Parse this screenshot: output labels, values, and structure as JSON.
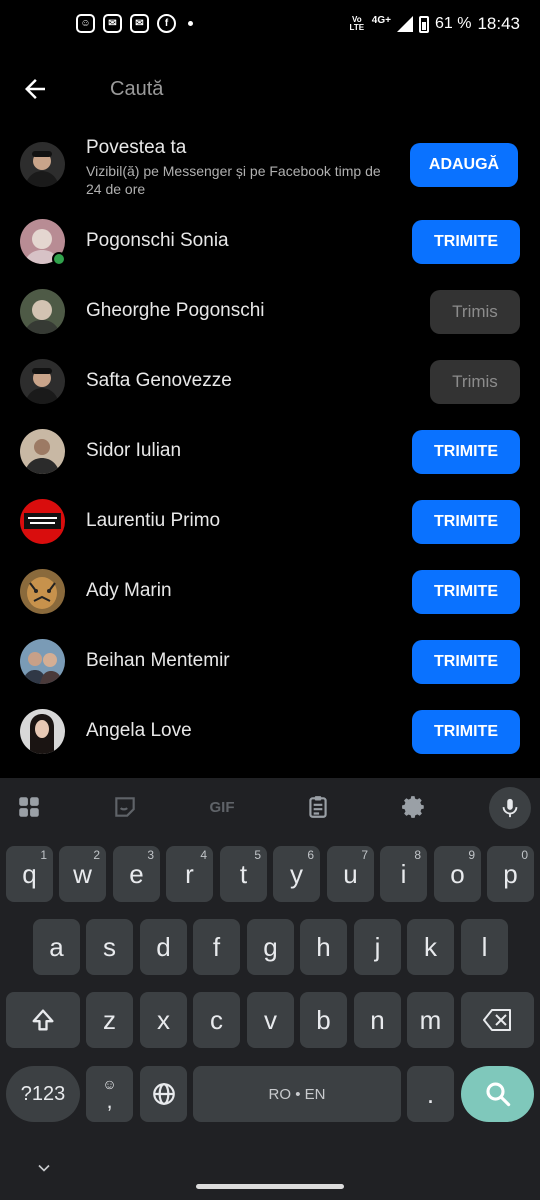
{
  "status_bar": {
    "battery": "61 %",
    "time": "18:43",
    "network": "4G+",
    "volte": "Vo LTE"
  },
  "header": {
    "search_placeholder": "Caută"
  },
  "story": {
    "title": "Povestea ta",
    "subtitle": "Vizibil(ă) pe Messenger și pe Facebook timp de 24 de ore",
    "button": "ADAUGĂ"
  },
  "contacts": [
    {
      "name": "Pogonschi Sonia",
      "button": "TRIMITE",
      "state": "send",
      "online": true
    },
    {
      "name": "Gheorghe Pogonschi",
      "button": "Trimis",
      "state": "sent",
      "online": false
    },
    {
      "name": "Safta Genovezze",
      "button": "Trimis",
      "state": "sent",
      "online": false
    },
    {
      "name": "Sidor Iulian",
      "button": "TRIMITE",
      "state": "send",
      "online": false
    },
    {
      "name": "Laurentiu Primo",
      "button": "TRIMITE",
      "state": "send",
      "online": false
    },
    {
      "name": "Ady Marin",
      "button": "TRIMITE",
      "state": "send",
      "online": false
    },
    {
      "name": "Beihan Mentemir",
      "button": "TRIMITE",
      "state": "send",
      "online": false
    },
    {
      "name": "Angela Love",
      "button": "TRIMITE",
      "state": "send",
      "online": false
    }
  ],
  "keyboard": {
    "toolbar": {
      "gif": "GIF"
    },
    "row1": [
      {
        "k": "q",
        "h": "1"
      },
      {
        "k": "w",
        "h": "2"
      },
      {
        "k": "e",
        "h": "3"
      },
      {
        "k": "r",
        "h": "4"
      },
      {
        "k": "t",
        "h": "5"
      },
      {
        "k": "y",
        "h": "6"
      },
      {
        "k": "u",
        "h": "7"
      },
      {
        "k": "i",
        "h": "8"
      },
      {
        "k": "o",
        "h": "9"
      },
      {
        "k": "p",
        "h": "0"
      }
    ],
    "row2": [
      "a",
      "s",
      "d",
      "f",
      "g",
      "h",
      "j",
      "k",
      "l"
    ],
    "row3": [
      "z",
      "x",
      "c",
      "v",
      "b",
      "n",
      "m"
    ],
    "symbols": "?123",
    "comma": ",",
    "space": "RO • EN",
    "period": "."
  },
  "colors": {
    "accent": "#0a72ff",
    "sent_button": "#333333",
    "online": "#31a24c",
    "enter_key": "#7fc8bb"
  }
}
